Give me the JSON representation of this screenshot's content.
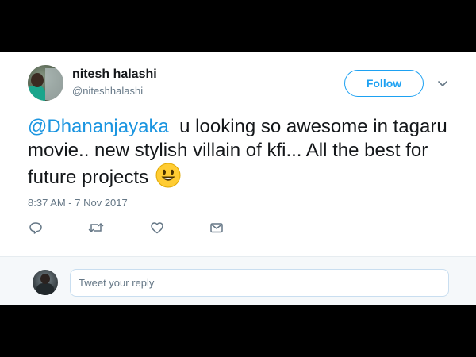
{
  "tweet": {
    "display_name": "nitesh halashi",
    "handle": "@niteshhalashi",
    "follow_label": "Follow",
    "mention": "@Dhananjayaka",
    "body": "  u looking so awesome in tagaru movie.. new stylish villain of kfi... All the best for future projects ",
    "timestamp": "8:37 AM - 7 Nov 2017",
    "emoji": "smiling-face-emoji"
  },
  "actions": {
    "icons": [
      "reply-icon",
      "retweet-icon",
      "like-icon",
      "direct-message-icon"
    ]
  },
  "reply": {
    "placeholder": "Tweet your reply"
  },
  "colors": {
    "accent": "#1da1f2",
    "link": "#1b95e0",
    "text": "#14171a",
    "muted": "#657786",
    "reply_bg": "#f5f8fa"
  }
}
